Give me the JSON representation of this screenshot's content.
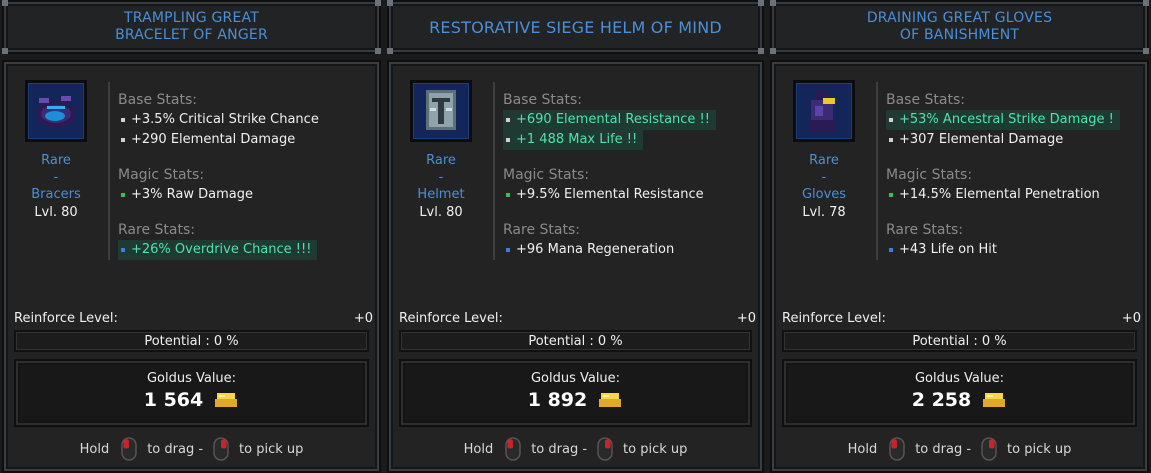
{
  "cards": [
    {
      "title": "TRAMPLING GREAT\nBRACELET OF ANGER",
      "rarity": "Rare",
      "dash": "-",
      "item_type": "Bracers",
      "level": "Lvl. 80",
      "icon": "bracers-icon",
      "base_header": "Base Stats:",
      "base_stats": [
        {
          "text": "+3.5% Critical Strike Chance",
          "highlight": false
        },
        {
          "text": "+290 Elemental Damage",
          "highlight": false
        }
      ],
      "magic_header": "Magic Stats:",
      "magic_stats": [
        {
          "text": "+3% Raw Damage",
          "highlight": false
        }
      ],
      "rare_header": "Rare Stats:",
      "rare_stats": [
        {
          "text": "+26% Overdrive Chance !!!",
          "highlight": true
        }
      ],
      "reinforce_label": "Reinforce Level:",
      "reinforce_value": "+0",
      "potential": "Potential : 0 %",
      "goldus_label": "Goldus Value:",
      "goldus_value": "1 564",
      "hint_hold": "Hold",
      "hint_drag": "to drag -",
      "hint_pick": "to pick up"
    },
    {
      "title": "RESTORATIVE SIEGE HELM OF MIND",
      "rarity": "Rare",
      "dash": "-",
      "item_type": "Helmet",
      "level": "Lvl. 80",
      "icon": "helmet-icon",
      "base_header": "Base Stats:",
      "base_stats": [
        {
          "text": "+690 Elemental Resistance !!",
          "highlight": true
        },
        {
          "text": "+1 488 Max Life !!",
          "highlight": true
        }
      ],
      "magic_header": "Magic Stats:",
      "magic_stats": [
        {
          "text": "+9.5% Elemental Resistance",
          "highlight": false
        }
      ],
      "rare_header": "Rare Stats:",
      "rare_stats": [
        {
          "text": "+96 Mana Regeneration",
          "highlight": false
        }
      ],
      "reinforce_label": "Reinforce Level:",
      "reinforce_value": "+0",
      "potential": "Potential : 0 %",
      "goldus_label": "Goldus Value:",
      "goldus_value": "1 892",
      "hint_hold": "Hold",
      "hint_drag": "to drag -",
      "hint_pick": "to pick up"
    },
    {
      "title": "DRAINING GREAT GLOVES\nOF BANISHMENT",
      "rarity": "Rare",
      "dash": "-",
      "item_type": "Gloves",
      "level": "Lvl. 78",
      "icon": "gloves-icon",
      "base_header": "Base Stats:",
      "base_stats": [
        {
          "text": "+53% Ancestral Strike Damage !",
          "highlight": true
        },
        {
          "text": "+307 Elemental Damage",
          "highlight": false
        }
      ],
      "magic_header": "Magic Stats:",
      "magic_stats": [
        {
          "text": "+14.5% Elemental Penetration",
          "highlight": false
        }
      ],
      "rare_header": "Rare Stats:",
      "rare_stats": [
        {
          "text": "+43 Life on Hit",
          "highlight": false
        }
      ],
      "reinforce_label": "Reinforce Level:",
      "reinforce_value": "+0",
      "potential": "Potential : 0 %",
      "goldus_label": "Goldus Value:",
      "goldus_value": "2 258",
      "hint_hold": "Hold",
      "hint_drag": "to drag -",
      "hint_pick": "to pick up"
    }
  ],
  "colors": {
    "title_blue": "#4a8fd8",
    "highlight_text": "#4fe3a9",
    "highlight_bg": "#1f3a32",
    "base_bullet": "#d0d0d0",
    "magic_bullet": "#3fbf4a",
    "rare_bullet": "#3a7fe0",
    "gold": "#f2c230"
  }
}
